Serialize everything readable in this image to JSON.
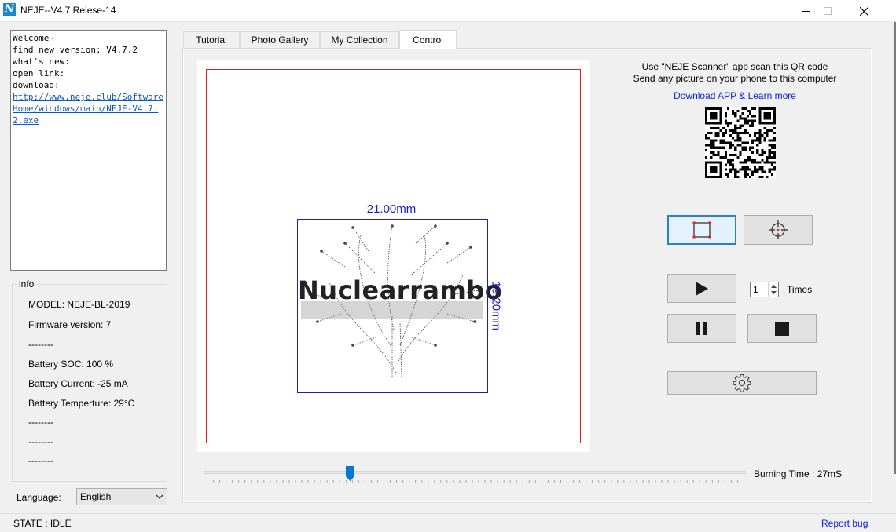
{
  "window": {
    "title": "NEJE--V4.7 Relese-14",
    "icon_letter": "N"
  },
  "log": {
    "lines": [
      "Welcome~",
      "find new version: V4.7.2",
      "what's new:",
      "open link:",
      "download:"
    ],
    "link": "http://www.neje.club/SoftwareHome/windows/main/NEJE-V4.7.2.exe"
  },
  "info": {
    "legend": "info",
    "model": "MODEL: NEJE-BL-2019",
    "firmware": "Firmware version: 7",
    "sep1": "--------",
    "battery_soc": "Battery SOC: 100 %",
    "battery_current": "Battery Current: -25 mA",
    "battery_temp": "Battery Temperture: 29°C",
    "sep2": "--------",
    "sep3": "--------",
    "sep4": "--------"
  },
  "language": {
    "label": "Language:",
    "selected": "English"
  },
  "tabs": [
    {
      "label": "Tutorial",
      "active": false
    },
    {
      "label": "Photo Gallery",
      "active": false
    },
    {
      "label": "My Collection",
      "active": false
    },
    {
      "label": "Control",
      "active": true
    }
  ],
  "canvas": {
    "width_label": "21.00mm",
    "height_label": "19.20mm",
    "image_text": "Nuclearrambo"
  },
  "qr": {
    "line1": "Use \"NEJE Scanner\" app scan this QR code",
    "line2": "Send any picture on your phone to this computer",
    "link": "Download  APP & Learn more"
  },
  "controls": {
    "times_value": "1",
    "times_label": "Times"
  },
  "burning": {
    "label": "Burning Time : 27mS",
    "slider_fraction": 0.27
  },
  "status": {
    "state": "STATE : IDLE",
    "report_bug": "Report bug"
  },
  "colors": {
    "red_frame": "#e02020",
    "blue_frame": "#1c1ccc",
    "link": "#0b1fd8",
    "accent": "#2a7fd4"
  },
  "icons": {
    "app": "neje-logo-icon",
    "minimize": "minimize-icon",
    "maximize": "maximize-icon",
    "close": "close-icon",
    "frame": "frame-square-icon",
    "crosshair": "crosshair-icon",
    "play": "play-icon",
    "pause": "pause-icon",
    "stop": "stop-icon",
    "settings": "gear-icon"
  }
}
